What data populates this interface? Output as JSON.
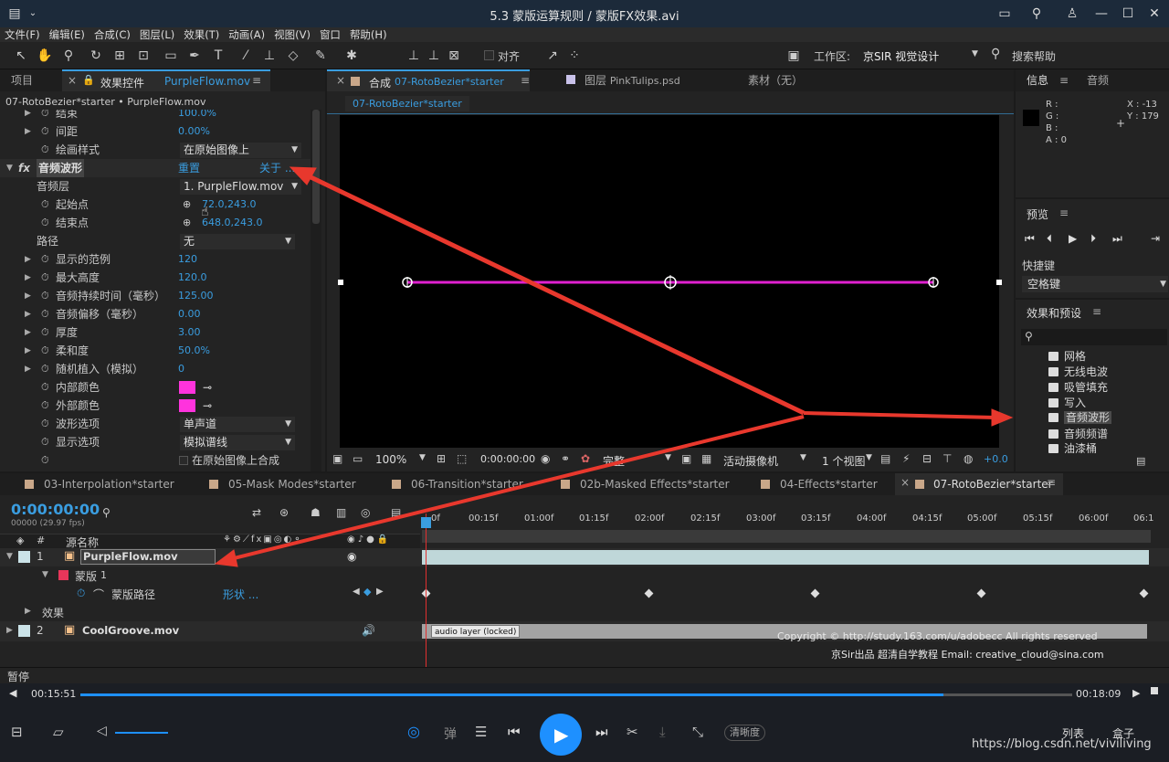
{
  "window": {
    "title": "5.3 蒙版运算规则 / 蒙版FX效果.avi"
  },
  "menu": [
    "文件(F)",
    "编辑(E)",
    "合成(C)",
    "图层(L)",
    "效果(T)",
    "动画(A)",
    "视图(V)",
    "窗口",
    "帮助(H)"
  ],
  "toolbar": {
    "align_label": "对齐",
    "workspace_label": "工作区:",
    "workspace_value": "京SIR 视觉设计",
    "search_label": "搜索帮助"
  },
  "left_panel": {
    "tab_project": "项目",
    "tab_effects": "效果控件",
    "tab_effects_file": "PurpleFlow.mov",
    "breadcrumb": "07-RotoBezier*starter • PurpleFlow.mov",
    "cut_label": "结束",
    "cut_value": "100.0%",
    "rows": [
      {
        "label": "间距",
        "value": "0.00%"
      },
      {
        "label": "绘画样式",
        "value": "在原始图像上"
      }
    ],
    "effect_name": "音频波形",
    "reset": "重置",
    "about": "关于 ...",
    "audio_layer_label": "音频层",
    "audio_layer_value": "1. PurpleFlow.mov",
    "start_label": "起始点",
    "start_value": "72.0,243.0",
    "end_label": "结束点",
    "end_value": "648.0,243.0",
    "path_label": "路径",
    "path_value": "无",
    "params": [
      {
        "label": "显示的范例",
        "value": "120"
      },
      {
        "label": "最大高度",
        "value": "120.0"
      },
      {
        "label": "音频持续时间（毫秒）",
        "value": "125.00"
      },
      {
        "label": "音频偏移（毫秒）",
        "value": "0.00"
      },
      {
        "label": "厚度",
        "value": "3.00"
      },
      {
        "label": "柔和度",
        "value": "50.0%"
      },
      {
        "label": "随机植入（模拟）",
        "value": "0"
      }
    ],
    "inner_color_label": "内部颜色",
    "outer_color_label": "外部颜色",
    "wave_label": "波形选项",
    "wave_value": "单声道",
    "display_label": "显示选项",
    "display_value": "模拟谱线",
    "checkbox_label": "在原始图像上合成",
    "color": "#ff33dd"
  },
  "comp_panel": {
    "tab_comp_prefix": "合成",
    "tab_comp": "07-RotoBezier*starter",
    "tab_layer_prefix": "图层",
    "tab_layer": "PinkTulips.psd",
    "tab_footage": "素材（无）",
    "subtab": "07-RotoBezier*starter",
    "zoom": "100%",
    "timecode": "0:00:00:00",
    "quality": "完整",
    "camera": "活动摄像机",
    "views": "1 个视图",
    "exposure": "+0.0",
    "line_color": "#e020d0"
  },
  "right_panel": {
    "tab_info": "信息",
    "tab_audio": "音频",
    "info": {
      "r": "R :",
      "g": "G :",
      "b": "B :",
      "a": "A : 0",
      "x": "X : -13",
      "y": "Y : 179"
    },
    "preview_title": "预览",
    "shortcut_label": "快捷键",
    "shortcut_value": "空格键",
    "effects_title": "效果和预设",
    "effects": [
      "网格",
      "无线电波",
      "吸管填充",
      "写入",
      "音频波形",
      "音频频谱",
      "油漆桶"
    ]
  },
  "timeline": {
    "tabs": [
      "03-Interpolation*starter",
      "05-Mask Modes*starter",
      "06-Transition*starter",
      "02b-Masked Effects*starter",
      "04-Effects*starter",
      "07-RotoBezier*starter"
    ],
    "timecode": "0:00:00:00",
    "fps": "00000 (29.97 fps)",
    "source_header": "源名称",
    "ruler": [
      "0f",
      "00:15f",
      "01:00f",
      "01:15f",
      "02:00f",
      "02:15f",
      "03:00f",
      "03:15f",
      "04:00f",
      "04:15f",
      "05:00f",
      "05:15f",
      "06:00f",
      "06:1"
    ],
    "layer1": {
      "num": "1",
      "name": "PurpleFlow.mov"
    },
    "mask": {
      "label": "蒙版",
      "num": "1"
    },
    "mask_path": {
      "label": "蒙版路径",
      "value": "形状 ..."
    },
    "effects_label": "效果",
    "layer2": {
      "num": "2",
      "name": "CoolGroove.mov"
    },
    "audio_locked": "audio layer (locked)",
    "copyright": "Copyright © http://study.163.com/u/adobecc All rights reserved",
    "credit": "京Sir出品  超清自学教程 Email: creative_cloud@sina.com"
  },
  "status": {
    "text": "暂停"
  },
  "player": {
    "elapsed": "00:15:51",
    "total": "00:18:09",
    "progress": 0.87,
    "danmu": "弹",
    "quality": "清晰度",
    "list": "列表",
    "box": "盒子",
    "watermark": "https://blog.csdn.net/viviliving"
  }
}
